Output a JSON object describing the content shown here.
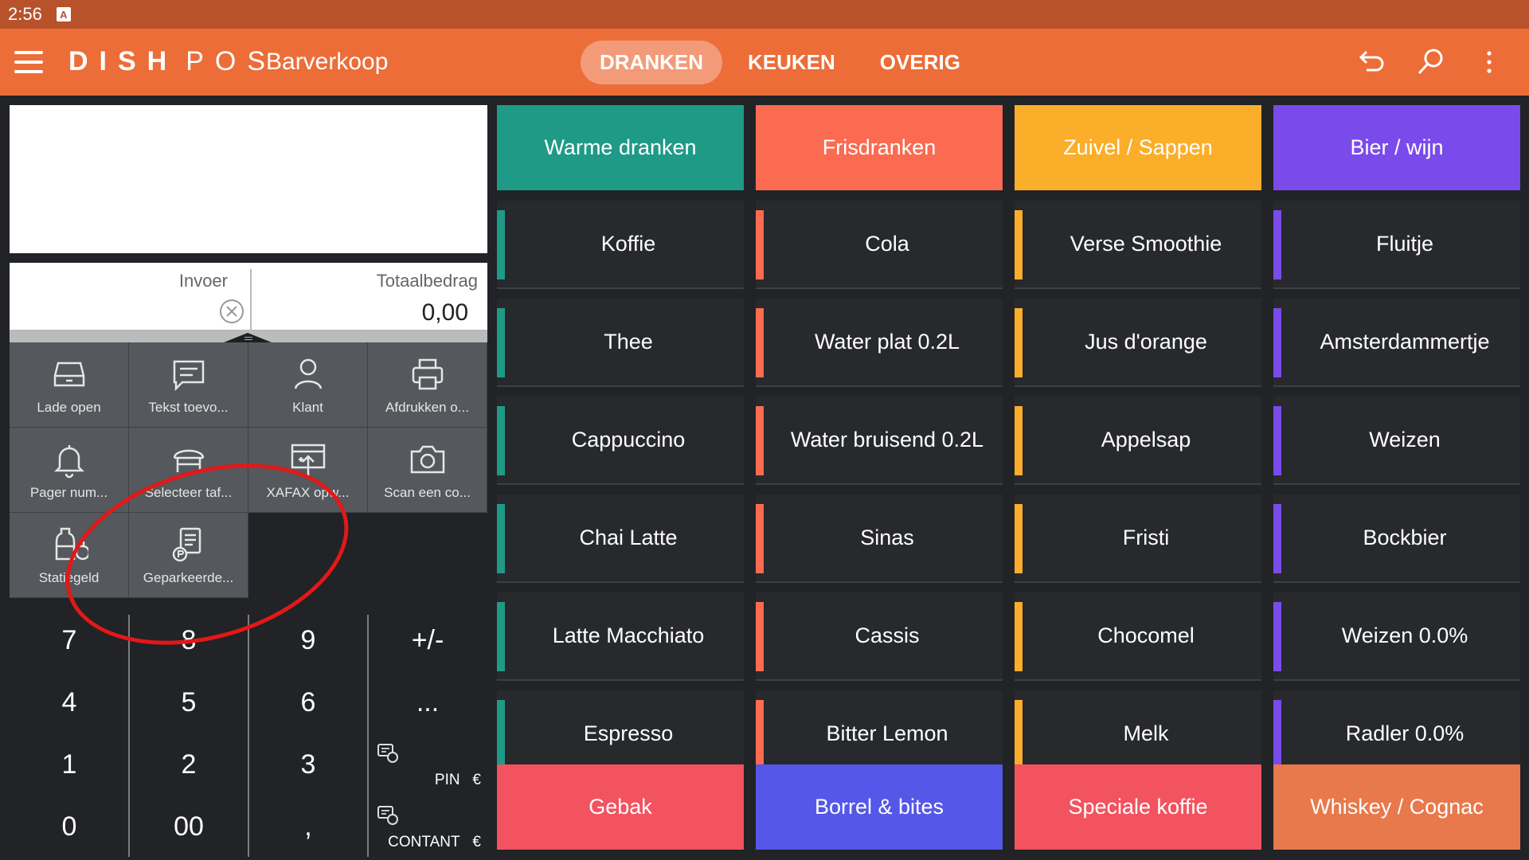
{
  "status_bar": {
    "time": "2:56",
    "notification_icon": "A"
  },
  "header": {
    "brand_left": "DISH",
    "brand_right": "POS",
    "title": "Barverkoop",
    "tabs": [
      {
        "label": "DRANKEN",
        "active": true
      },
      {
        "label": "KEUKEN",
        "active": false
      },
      {
        "label": "OVERIG",
        "active": false
      }
    ],
    "icons": [
      "undo-icon",
      "search-icon",
      "more-vert-icon"
    ]
  },
  "entry": {
    "input_label": "Invoer",
    "total_label": "Totaalbedrag",
    "total_value": "0,00"
  },
  "actions": [
    {
      "label": "Lade open",
      "icon": "drawer-icon"
    },
    {
      "label": "Tekst toevo...",
      "icon": "message-icon"
    },
    {
      "label": "Klant",
      "icon": "user-icon"
    },
    {
      "label": "Afdrukken o...",
      "icon": "printer-icon"
    },
    {
      "label": "Pager num...",
      "icon": "bell-icon"
    },
    {
      "label": "Selecteer taf...",
      "icon": "table-icon"
    },
    {
      "label": "XAFAX opw...",
      "icon": "upload-icon"
    },
    {
      "label": "Scan een co...",
      "icon": "camera-icon"
    },
    {
      "label": "Statiegeld",
      "icon": "bottle-refund-icon"
    },
    {
      "label": "Geparkeerde...",
      "icon": "parked-receipt-icon"
    }
  ],
  "keypad": {
    "rows": [
      [
        "7",
        "8",
        "9",
        "+/-"
      ],
      [
        "4",
        "5",
        "6",
        "..."
      ],
      [
        "1",
        "2",
        "3"
      ],
      [
        "0",
        "00",
        ","
      ]
    ],
    "pay_pin_label": "PIN",
    "pay_cash_label": "CONTANT",
    "currency": "€"
  },
  "categories_top": [
    {
      "label": "Warme dranken",
      "color": "#1f9a87"
    },
    {
      "label": "Frisdranken",
      "color": "#fb6b51"
    },
    {
      "label": "Zuivel / Sappen",
      "color": "#fbae2a"
    },
    {
      "label": "Bier / wijn",
      "color": "#7a4bea"
    }
  ],
  "products": [
    [
      "Koffie",
      "Thee",
      "Cappuccino",
      "Chai Latte",
      "Latte Macchiato",
      "Espresso"
    ],
    [
      "Cola",
      "Water plat 0.2L",
      "Water bruisend 0.2L",
      "Sinas",
      "Cassis",
      "Bitter Lemon"
    ],
    [
      "Verse Smoothie",
      "Jus d'orange",
      "Appelsap",
      "Fristi",
      "Chocomel",
      "Melk"
    ],
    [
      "Fluitje",
      "Amsterdammertje",
      "Weizen",
      "Bockbier",
      "Weizen 0.0%",
      "Radler 0.0%"
    ]
  ],
  "categories_bottom": [
    {
      "label": "Gebak",
      "color": "#f3525f"
    },
    {
      "label": "Borrel & bites",
      "color": "#5457e8"
    },
    {
      "label": "Speciale koffie",
      "color": "#f3525f"
    },
    {
      "label": "Whiskey / Cognac",
      "color": "#e8794c"
    }
  ]
}
